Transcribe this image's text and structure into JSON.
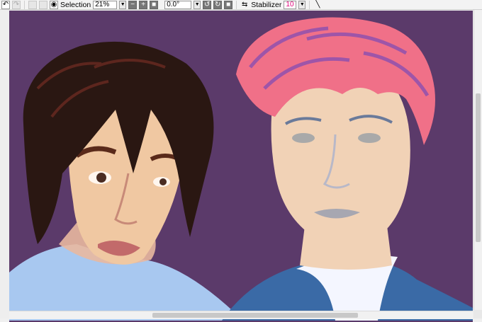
{
  "toolbar": {
    "selection_label": "Selection",
    "zoom_value": "21%",
    "rotation_value": "0.0°",
    "stabilizer_label": "Stabilizer",
    "stabilizer_value": "10"
  },
  "colors": {
    "canvas_background": "#5b3a6a",
    "stabilizer_value_text": "#e0007a"
  },
  "icons": [
    "undo-icon",
    "redo-icon",
    "eye-icon",
    "zoom-out-icon",
    "zoom-in-icon",
    "fit-icon",
    "rotate-left-icon",
    "rotate-right-icon",
    "reset-rotation-icon",
    "flip-icon",
    "pen-icon"
  ]
}
